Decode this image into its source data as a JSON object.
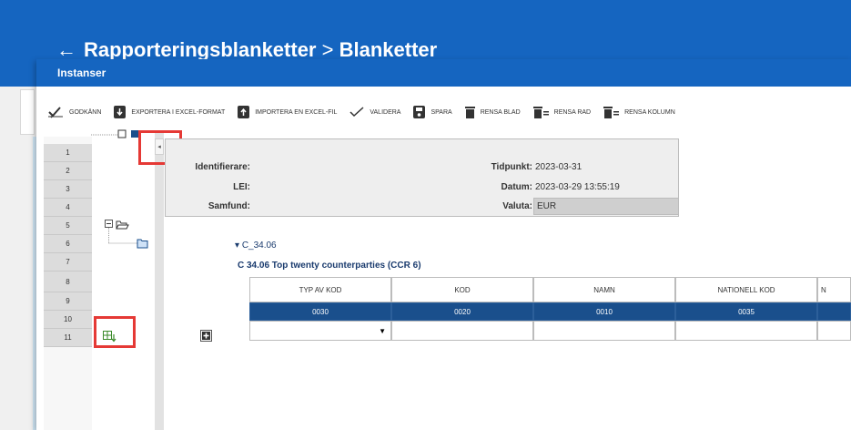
{
  "page": {
    "title_part1": "Rapporteringsblanketter",
    "separator": ">",
    "title_part2": "Blanketter"
  },
  "dialog": {
    "title": "Instanser"
  },
  "toolbar": {
    "godkann": "GODKÄNN",
    "exportera": "EXPORTERA I EXCEL-FORMAT",
    "importera": "IMPORTERA EN EXCEL-FIL",
    "validera": "VALIDERA",
    "spara": "SPARA",
    "rensa_blad": "RENSA BLAD",
    "rensa_rad": "RENSA RAD",
    "rensa_kolumn": "RENSA KOLUMN"
  },
  "rows": [
    "1",
    "2",
    "3",
    "4",
    "5",
    "6",
    "7",
    "8",
    "9",
    "10",
    "11"
  ],
  "info": {
    "identifierare_label": "Identifierare:",
    "lei_label": "LEI:",
    "samfund_label": "Samfund:",
    "tidpunkt_label": "Tidpunkt:",
    "tidpunkt_value": "2023-03-31",
    "datum_label": "Datum:",
    "datum_value": "2023-03-29 13:55:19",
    "valuta_label": "Valuta:",
    "valuta_value": "EUR"
  },
  "section": {
    "code": "C_34.06",
    "title": "C 34.06 Top twenty counterparties (CCR 6)"
  },
  "table": {
    "headers": [
      "TYP AV KOD",
      "KOD",
      "NAMN",
      "NATIONELL KOD",
      "N"
    ],
    "codes": [
      "0030",
      "0020",
      "0010",
      "0035",
      ""
    ]
  },
  "colors": {
    "brand_blue": "#1565c0",
    "code_row_bg": "#1a4f8c",
    "highlight_red": "#e53935",
    "title_blue": "#1a3b6e"
  }
}
